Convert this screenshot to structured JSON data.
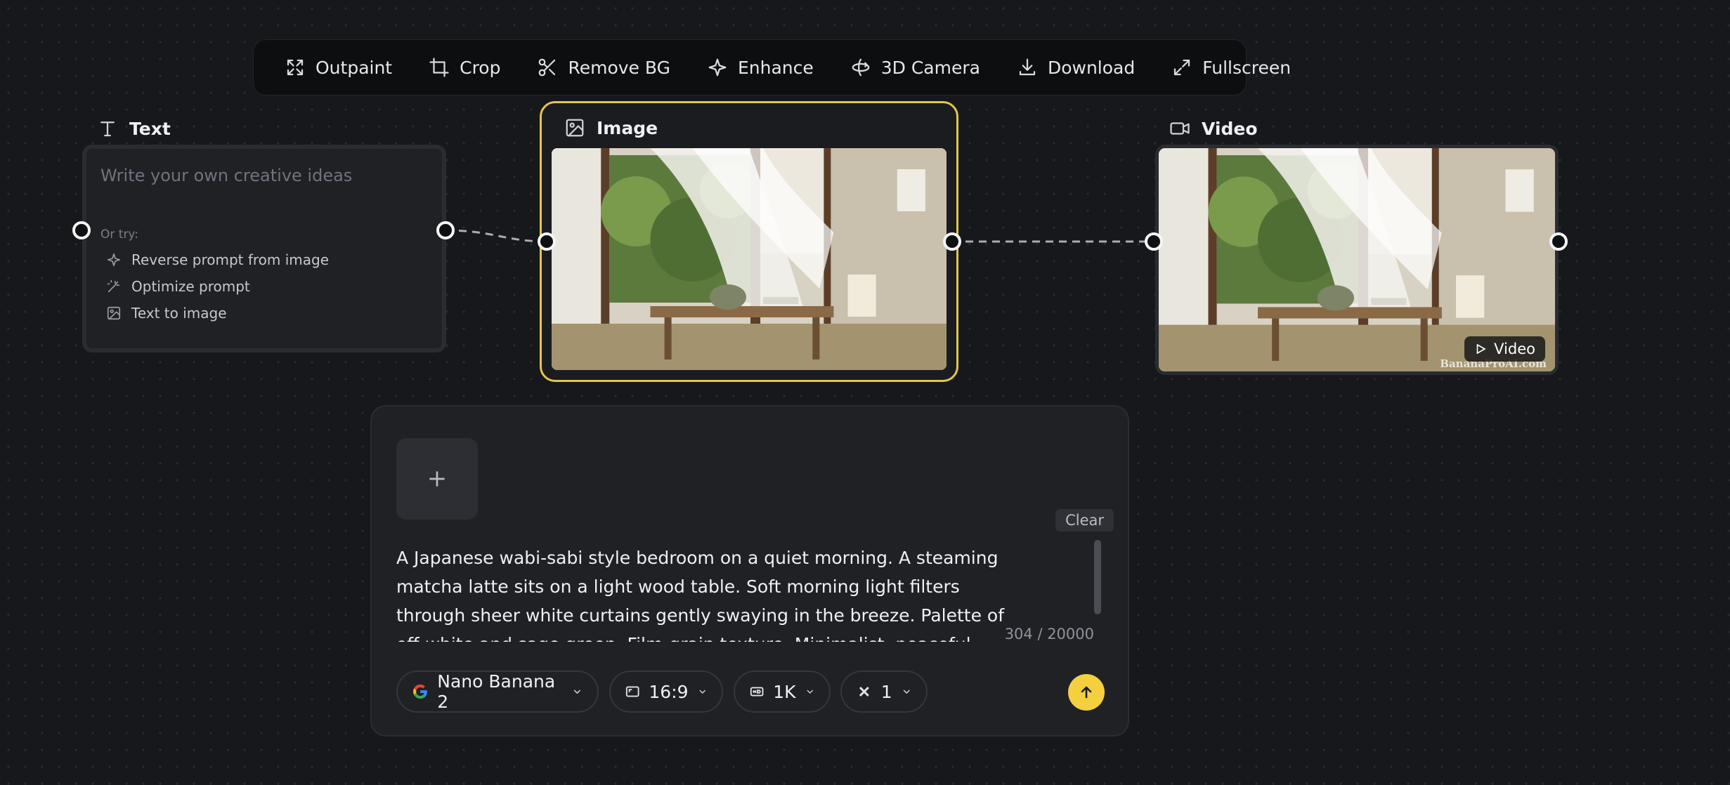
{
  "toolbar": {
    "items": [
      {
        "label": "Outpaint",
        "icon": "expand-icon"
      },
      {
        "label": "Crop",
        "icon": "crop-icon"
      },
      {
        "label": "Remove BG",
        "icon": "scissors-icon"
      },
      {
        "label": "Enhance",
        "icon": "sparkle-icon"
      },
      {
        "label": "3D Camera",
        "icon": "rotate-3d-icon"
      },
      {
        "label": "Download",
        "icon": "download-icon"
      },
      {
        "label": "Fullscreen",
        "icon": "fullscreen-icon"
      }
    ]
  },
  "text_node": {
    "label": "Text",
    "placeholder": "Write your own creative ideas",
    "or_try": "Or try:",
    "suggestions": [
      {
        "label": "Reverse prompt from image",
        "icon": "sparkle-icon"
      },
      {
        "label": "Optimize prompt",
        "icon": "magic-wand-icon"
      },
      {
        "label": "Text to image",
        "icon": "image-icon"
      }
    ]
  },
  "image_node": {
    "label": "Image",
    "accent": "#e4c54a"
  },
  "video_node": {
    "label": "Video",
    "badge": "Video",
    "watermark": "BananaProAI.com"
  },
  "composer": {
    "clear_label": "Clear",
    "prompt": "A Japanese wabi-sabi style bedroom on a quiet morning. A steaming matcha latte sits on a light wood table. Soft morning light filters through sheer white curtains gently swaying in the breeze. Palette of off-white and sage green. Film-grain texture. Minimalist, peaceful atmosphere. Vertical composition.",
    "counter": "304 / 20000",
    "model": "Nano Banana 2",
    "aspect": "16:9",
    "resolution": "1K",
    "count": "1",
    "send_color": "#f4d03f"
  }
}
